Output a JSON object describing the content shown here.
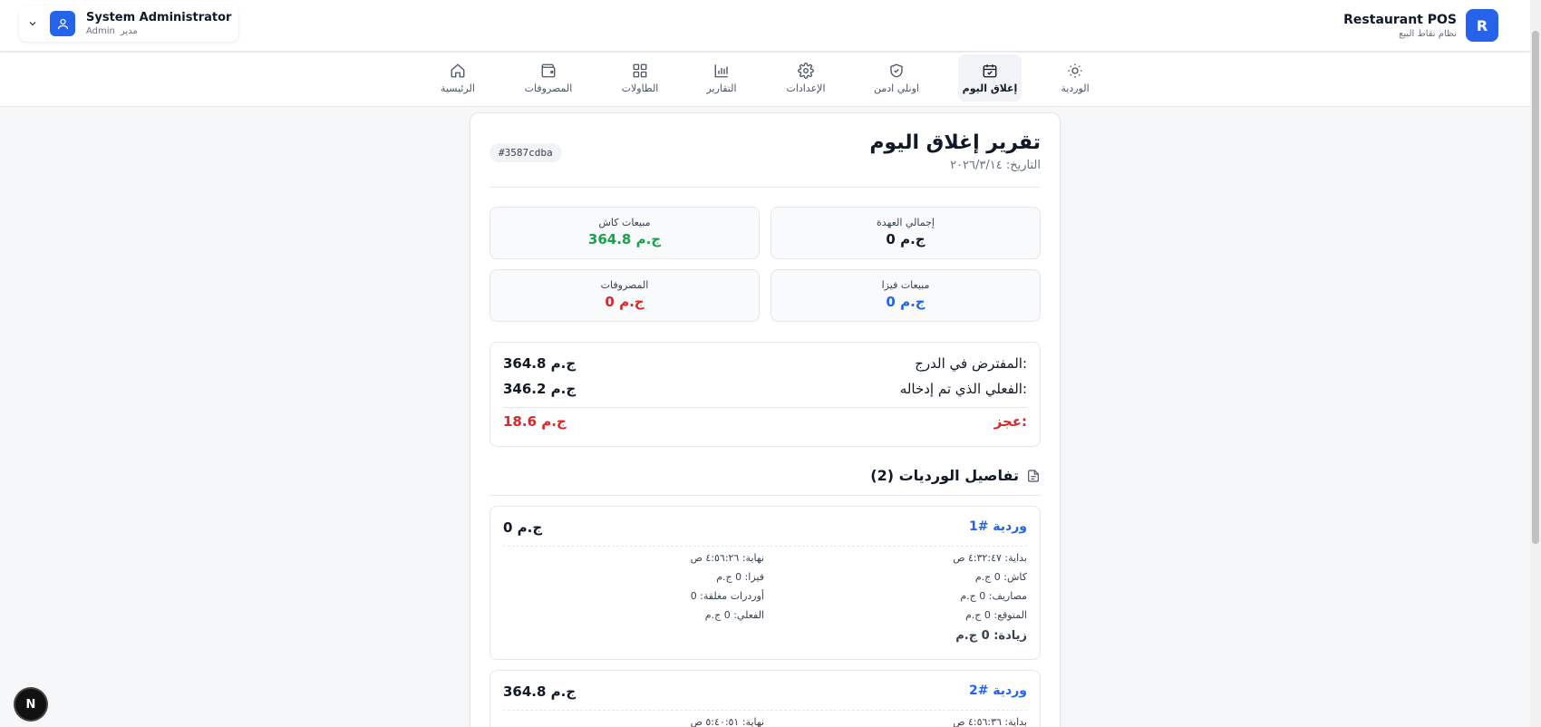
{
  "header": {
    "brand_title": "Restaurant POS",
    "brand_subtitle": "نظام نقاط البيع",
    "brand_logo_letter": "R",
    "user_name": "System Administrator",
    "user_role_ar": "مدير",
    "user_role_en": "Admin"
  },
  "nav": [
    {
      "label": "الوردية",
      "icon": "sun-icon",
      "active": false
    },
    {
      "label": "إغلاق اليوم",
      "icon": "calendar-check-icon",
      "active": true
    },
    {
      "label": "اونلي ادمن",
      "icon": "shield-check-icon",
      "active": false
    },
    {
      "label": "الإعدادات",
      "icon": "gear-icon",
      "active": false
    },
    {
      "label": "التقارير",
      "icon": "bar-chart-icon",
      "active": false
    },
    {
      "label": "الطاولات",
      "icon": "grid-icon",
      "active": false
    },
    {
      "label": "المصروفات",
      "icon": "wallet-icon",
      "active": false
    },
    {
      "label": "الرئيسية",
      "icon": "home-icon",
      "active": false
    }
  ],
  "report": {
    "title": "تقرير إغلاق اليوم",
    "date": "التاريخ: ٢٠٢٦/٣/١٤",
    "id_badge": "#3587cdba",
    "stats": {
      "custody_label": "إجمالي العهدة",
      "custody_value": "0 ج.م",
      "cash_label": "مبيعات كاش",
      "cash_value": "364.8 ج.م",
      "visa_label": "مبيعات فيزا",
      "visa_value": "0 ج.م",
      "expenses_label": "المصروفات",
      "expenses_value": "0 ج.م"
    },
    "drawer": {
      "expected_label": "المفترض في الدرج:",
      "expected_value": "364.8 ج.م",
      "actual_label": "الفعلي الذي تم إدخاله:",
      "actual_value": "346.2 ج.م",
      "deficit_label": "عجز:",
      "deficit_value": "18.6 ج.م"
    },
    "shifts_heading": "تفاصيل الورديات (2)",
    "shifts": [
      {
        "title": "وردية #1",
        "total": "0 ج.م",
        "start": "بداية: ٤:٣٢:٤٧ ص",
        "end": "نهاية: ٤:٥٦:٢٦ ص",
        "cash": "كاش: 0 ج.م",
        "visa": "فيزا: 0 ج.م",
        "expenses": "مصاريف: 0 ج.م",
        "closed_orders": "أوردرات مغلقة: 0",
        "expected": "المتوقع: 0 ج.م",
        "actual": "الفعلي: 0 ج.م",
        "surplus": "زيادة: 0 ج.م"
      },
      {
        "title": "وردية #2",
        "total": "364.8 ج.م",
        "start": "بداية: ٤:٥٦:٣٦ ص",
        "end": "نهاية: ٥:٤٠:٥١ ص"
      }
    ]
  },
  "floating_badge": "N",
  "colors": {
    "accent": "#2563eb",
    "positive": "#16a34a",
    "negative": "#dc2626"
  }
}
